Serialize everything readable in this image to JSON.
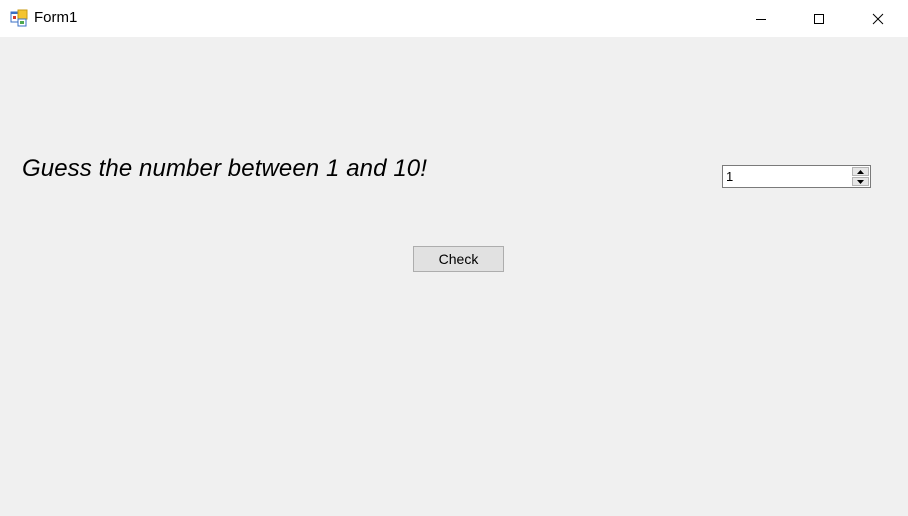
{
  "window": {
    "title": "Form1",
    "icons": {
      "app": "winforms-app-icon",
      "minimize": "minimize-icon",
      "maximize": "maximize-icon",
      "close": "close-icon"
    }
  },
  "form": {
    "prompt_text": "Guess the number between 1 and 10!",
    "guess_value": "1",
    "check_label": "Check"
  },
  "colors": {
    "client_background": "#f0f0f0",
    "titlebar_background": "#ffffff",
    "button_background": "#e1e1e1",
    "button_border": "#adadad"
  }
}
